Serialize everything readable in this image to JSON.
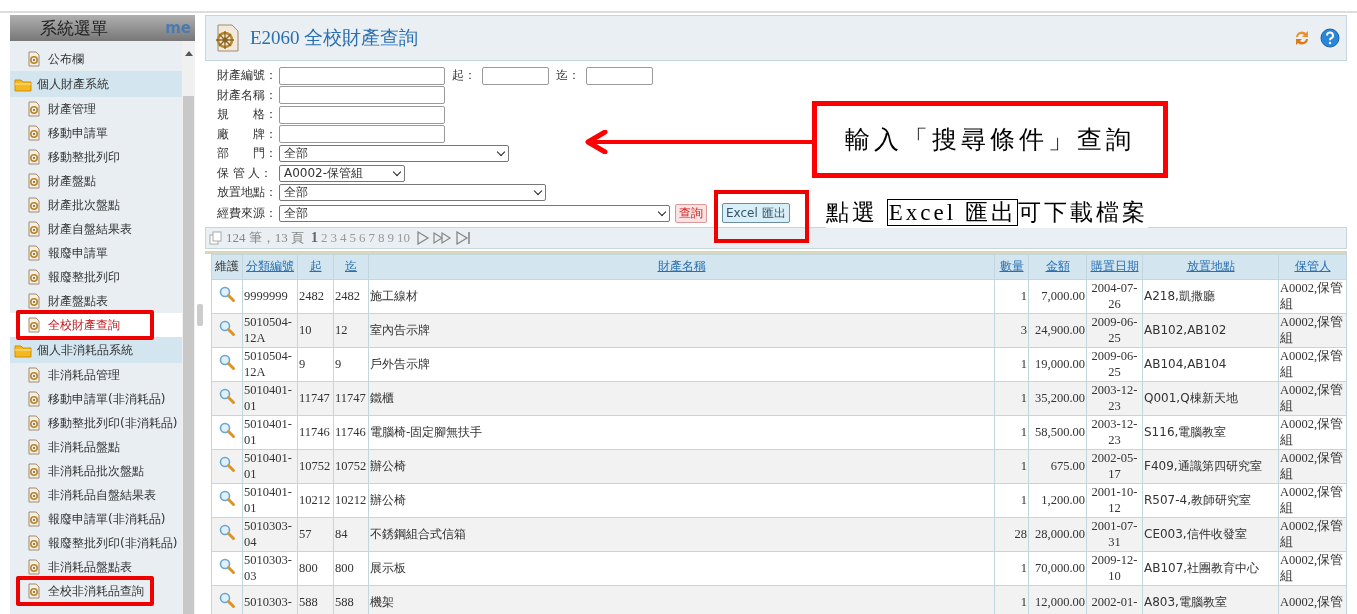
{
  "sidebar": {
    "title": "系統選單",
    "tab": "me",
    "items": [
      {
        "label": "公布欄",
        "kind": "page",
        "selected": false,
        "highlighted": false
      },
      {
        "label": "個人財產系統",
        "kind": "folder",
        "children": [
          {
            "label": "財產管理",
            "kind": "page",
            "selected": false,
            "highlighted": false
          },
          {
            "label": "移動申請單",
            "kind": "page",
            "selected": false,
            "highlighted": false
          },
          {
            "label": "移動整批列印",
            "kind": "page",
            "selected": false,
            "highlighted": false
          },
          {
            "label": "財產盤點",
            "kind": "page",
            "selected": false,
            "highlighted": false
          },
          {
            "label": "財產批次盤點",
            "kind": "page",
            "selected": false,
            "highlighted": false
          },
          {
            "label": "財產自盤結果表",
            "kind": "page",
            "selected": false,
            "highlighted": false
          },
          {
            "label": "報廢申請單",
            "kind": "page",
            "selected": false,
            "highlighted": false
          },
          {
            "label": "報廢整批列印",
            "kind": "page",
            "selected": false,
            "highlighted": false
          },
          {
            "label": "財產盤點表",
            "kind": "page",
            "selected": false,
            "highlighted": false
          },
          {
            "label": "全校財產查詢",
            "kind": "page",
            "selected": true,
            "highlighted": true
          }
        ]
      },
      {
        "label": "個人非消耗品系統",
        "kind": "folder",
        "children": [
          {
            "label": "非消耗品管理",
            "kind": "page",
            "selected": false,
            "highlighted": false
          },
          {
            "label": "移動申請單(非消耗品)",
            "kind": "page",
            "selected": false,
            "highlighted": false
          },
          {
            "label": "移動整批列印(非消耗品)",
            "kind": "page",
            "selected": false,
            "highlighted": false
          },
          {
            "label": "非消耗品盤點",
            "kind": "page",
            "selected": false,
            "highlighted": false
          },
          {
            "label": "非消耗品批次盤點",
            "kind": "page",
            "selected": false,
            "highlighted": false
          },
          {
            "label": "非消耗品自盤結果表",
            "kind": "page",
            "selected": false,
            "highlighted": false
          },
          {
            "label": "報廢申請單(非消耗品)",
            "kind": "page",
            "selected": false,
            "highlighted": false
          },
          {
            "label": "報廢整批列印(非消耗品)",
            "kind": "page",
            "selected": false,
            "highlighted": false
          },
          {
            "label": "非消耗品盤點表",
            "kind": "page",
            "selected": false,
            "highlighted": false
          },
          {
            "label": "全校非消耗品查詢",
            "kind": "page",
            "selected": false,
            "highlighted": true
          }
        ]
      }
    ]
  },
  "page": {
    "title": "E2060 全校財產查詢"
  },
  "form": {
    "rows": [
      {
        "label": "財產編號：",
        "kind": "text",
        "extra": [
          {
            "label": "起：",
            "kind": "text"
          },
          {
            "label": "迄：",
            "kind": "text"
          }
        ]
      },
      {
        "label": "財產名稱：",
        "kind": "text"
      },
      {
        "label": "規　　格：",
        "kind": "text"
      },
      {
        "label": "廠　　牌：",
        "kind": "text"
      },
      {
        "label": "部　　門：",
        "kind": "select",
        "value": "全部"
      },
      {
        "label": "保 管 人：",
        "kind": "select",
        "value": "A0002-保管組"
      },
      {
        "label": "放置地點：",
        "kind": "select",
        "value": "全部"
      },
      {
        "label": "經費來源：",
        "kind": "select",
        "value": "全部"
      }
    ],
    "buttons": [
      {
        "label": "查詢",
        "kind": "query",
        "highlighted": false
      },
      {
        "label": "Excel 匯出",
        "kind": "export",
        "highlighted": true
      }
    ]
  },
  "pager": {
    "summary": "124 筆，13 頁",
    "pages": [
      {
        "label": "1",
        "selected": true
      },
      {
        "label": "2",
        "selected": false
      },
      {
        "label": "3",
        "selected": false
      },
      {
        "label": "4",
        "selected": false
      },
      {
        "label": "5",
        "selected": false
      },
      {
        "label": "6",
        "selected": false
      },
      {
        "label": "7",
        "selected": false
      },
      {
        "label": "8",
        "selected": false
      },
      {
        "label": "9",
        "selected": false
      },
      {
        "label": "10",
        "selected": false
      }
    ]
  },
  "table": {
    "columns": [
      {
        "label": "維護",
        "sortable": false
      },
      {
        "label": "分類編號",
        "sortable": true
      },
      {
        "label": "起",
        "sortable": true
      },
      {
        "label": "迄",
        "sortable": true
      },
      {
        "label": "財產名稱",
        "sortable": true
      },
      {
        "label": "數量",
        "sortable": true
      },
      {
        "label": "金額",
        "sortable": true
      },
      {
        "label": "購置日期",
        "sortable": true
      },
      {
        "label": "放置地點",
        "sortable": true
      },
      {
        "label": "保管人",
        "sortable": true
      }
    ],
    "rows": [
      [
        "",
        "9999999",
        "2482",
        "2482",
        "施工線材",
        "1",
        "7,000.00",
        "2004-07-26",
        "A218,凱撒廳",
        "A0002,保管組"
      ],
      [
        "",
        "5010504-12A",
        "10",
        "12",
        "室內告示牌",
        "3",
        "24,900.00",
        "2009-06-25",
        "AB102,AB102",
        "A0002,保管組"
      ],
      [
        "",
        "5010504-12A",
        "9",
        "9",
        "戶外告示牌",
        "1",
        "19,000.00",
        "2009-06-25",
        "AB104,AB104",
        "A0002,保管組"
      ],
      [
        "",
        "5010401-01",
        "11747",
        "11747",
        "鐵櫃",
        "1",
        "35,200.00",
        "2003-12-23",
        "Q001,Q棟新天地",
        "A0002,保管組"
      ],
      [
        "",
        "5010401-01",
        "11746",
        "11746",
        "電腦椅-固定腳無扶手",
        "1",
        "58,500.00",
        "2003-12-23",
        "S116,電腦教室",
        "A0002,保管組"
      ],
      [
        "",
        "5010401-01",
        "10752",
        "10752",
        "辦公椅",
        "1",
        "675.00",
        "2002-05-17",
        "F409,通識第四研究室",
        "A0002,保管組"
      ],
      [
        "",
        "5010401-01",
        "10212",
        "10212",
        "辦公椅",
        "1",
        "1,200.00",
        "2001-10-12",
        "R507-4,教師研究室",
        "A0002,保管組"
      ],
      [
        "",
        "5010303-04",
        "57",
        "84",
        "不銹鋼組合式信箱",
        "28",
        "28,000.00",
        "2001-07-31",
        "CE003,信件收發室",
        "A0002,保管組"
      ],
      [
        "",
        "5010303-03",
        "800",
        "800",
        "展示板",
        "1",
        "70,000.00",
        "2009-12-10",
        "AB107,社團教育中心",
        "A0002,保管組"
      ],
      [
        "",
        "5010303-",
        "588",
        "588",
        "機架",
        "1",
        "12,000.00",
        "2002-01-",
        "A803,電腦教室",
        "A0002,保管"
      ]
    ]
  },
  "annotations": [
    {
      "kind": "arrow"
    },
    {
      "kind": "boxed",
      "text": "輸入「搜尋條件」查詢"
    },
    {
      "kind": "inline",
      "before": "點選 ",
      "boxed": "Excel 匯出",
      "after": "可下載檔案"
    }
  ]
}
